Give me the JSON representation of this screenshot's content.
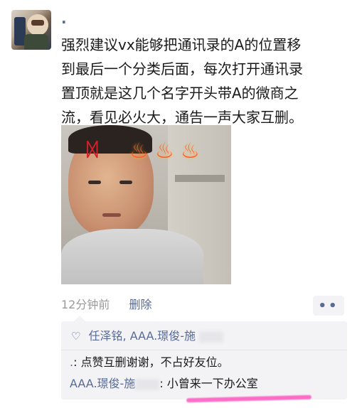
{
  "post": {
    "nickname": ".",
    "content": "强烈建议vx能够把通讯录的A的位置移\n到最后一个分类后面，每次打开通讯录\n置顶就是这几个名字开头带A的微商之\n流，看见必火大，通告一声大家互删。",
    "time": "12分钟前",
    "delete_label": "删除",
    "more_label": "••"
  },
  "interactions": {
    "likes": "任泽铭, AAA.璟俊-施",
    "comments": [
      {
        "author": ".",
        "separator": ": ",
        "text": "点赞互删谢谢，不占好友位。"
      },
      {
        "author": "AAA.璟俊-施",
        "separator": ": ",
        "text": "小曾来一下办公室"
      }
    ]
  },
  "colors": {
    "link": "#576b95",
    "highlight_underline": "#ff3fb8",
    "comment_bg": "#f3f3f5"
  },
  "icons": {
    "like": "heart-outline-icon",
    "more": "more-dots-icon",
    "anger": "anger-symbol-icon",
    "fire": "fire-icon"
  }
}
